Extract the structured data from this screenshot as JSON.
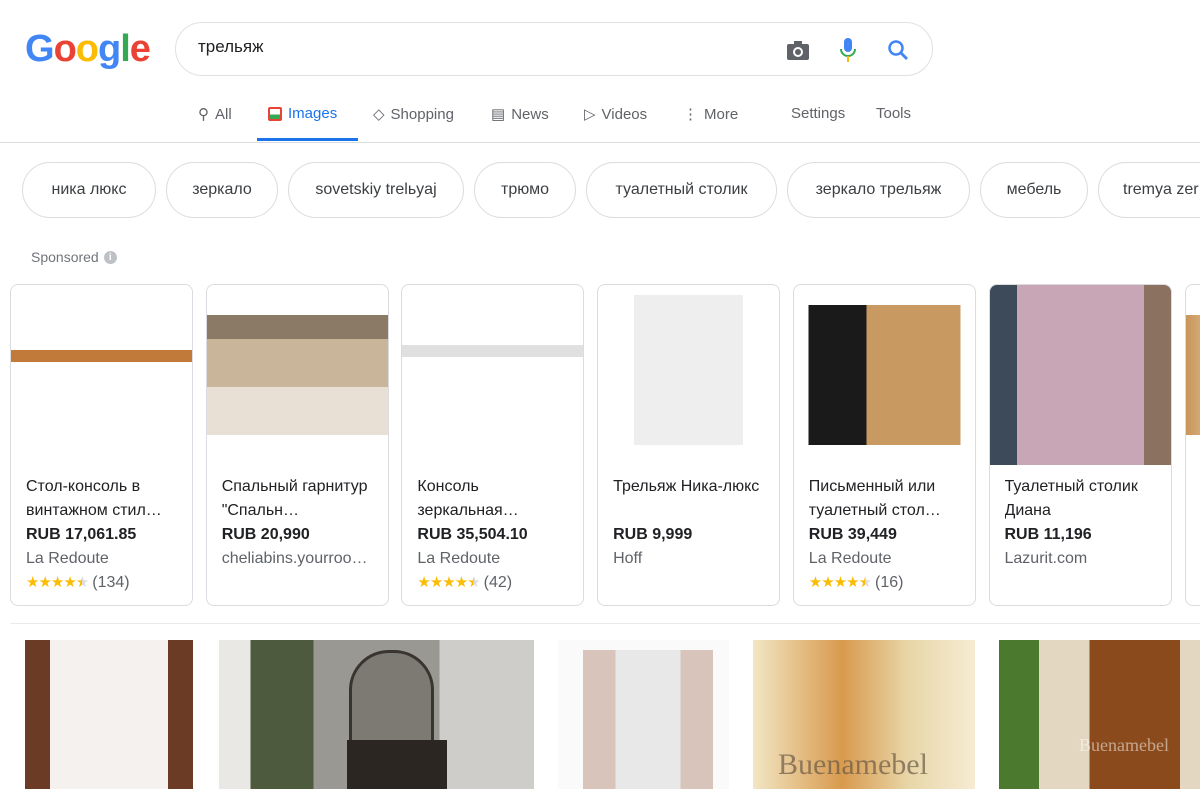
{
  "logo": "Google",
  "search": {
    "value": "трельяж"
  },
  "tabs": [
    {
      "label": "All",
      "icon": "search-icon"
    },
    {
      "label": "Images",
      "icon": "image-icon",
      "active": true
    },
    {
      "label": "Shopping",
      "icon": "tag-icon"
    },
    {
      "label": "News",
      "icon": "news-icon"
    },
    {
      "label": "Videos",
      "icon": "play-icon"
    },
    {
      "label": "More",
      "icon": "more-vert-icon"
    }
  ],
  "settings": "Settings",
  "tools": "Tools",
  "chips": [
    "ника люкс",
    "зеркало",
    "sovetskiy trelьyaj",
    "трюмо",
    "туалетный столик",
    "зеркало трельяж",
    "мебель",
    "tremya zer"
  ],
  "sponsored": "Sponsored",
  "products": [
    {
      "title": "Стол-консоль в винтажном стил…",
      "price": "RUB 17,061.85",
      "store": "La Redoute",
      "rating": 4.5,
      "reviews": "(134)"
    },
    {
      "title": "Спальный гарнитур \"Спальн…",
      "price": "RUB 20,990",
      "store": "cheliabins.yourroo…"
    },
    {
      "title": "Консоль зеркальная…",
      "price": "RUB 35,504.10",
      "store": "La Redoute",
      "rating": 4.5,
      "reviews": "(42)"
    },
    {
      "title": "Трельяж Ника-люкс",
      "price": "RUB 9,999",
      "store": "Hoff"
    },
    {
      "title": "Письменный или туалетный стол…",
      "price": "RUB 39,449",
      "store": "La Redoute",
      "rating": 4.5,
      "reviews": "(16)"
    },
    {
      "title": "Туалетный столик Диана",
      "price": "RUB 11,196",
      "store": "Lazurit.com"
    }
  ],
  "watermarks": [
    "Buenamebel",
    "Buenamebel"
  ],
  "colors": {
    "accent": "#1a73e8",
    "star": "#fbbc04"
  }
}
